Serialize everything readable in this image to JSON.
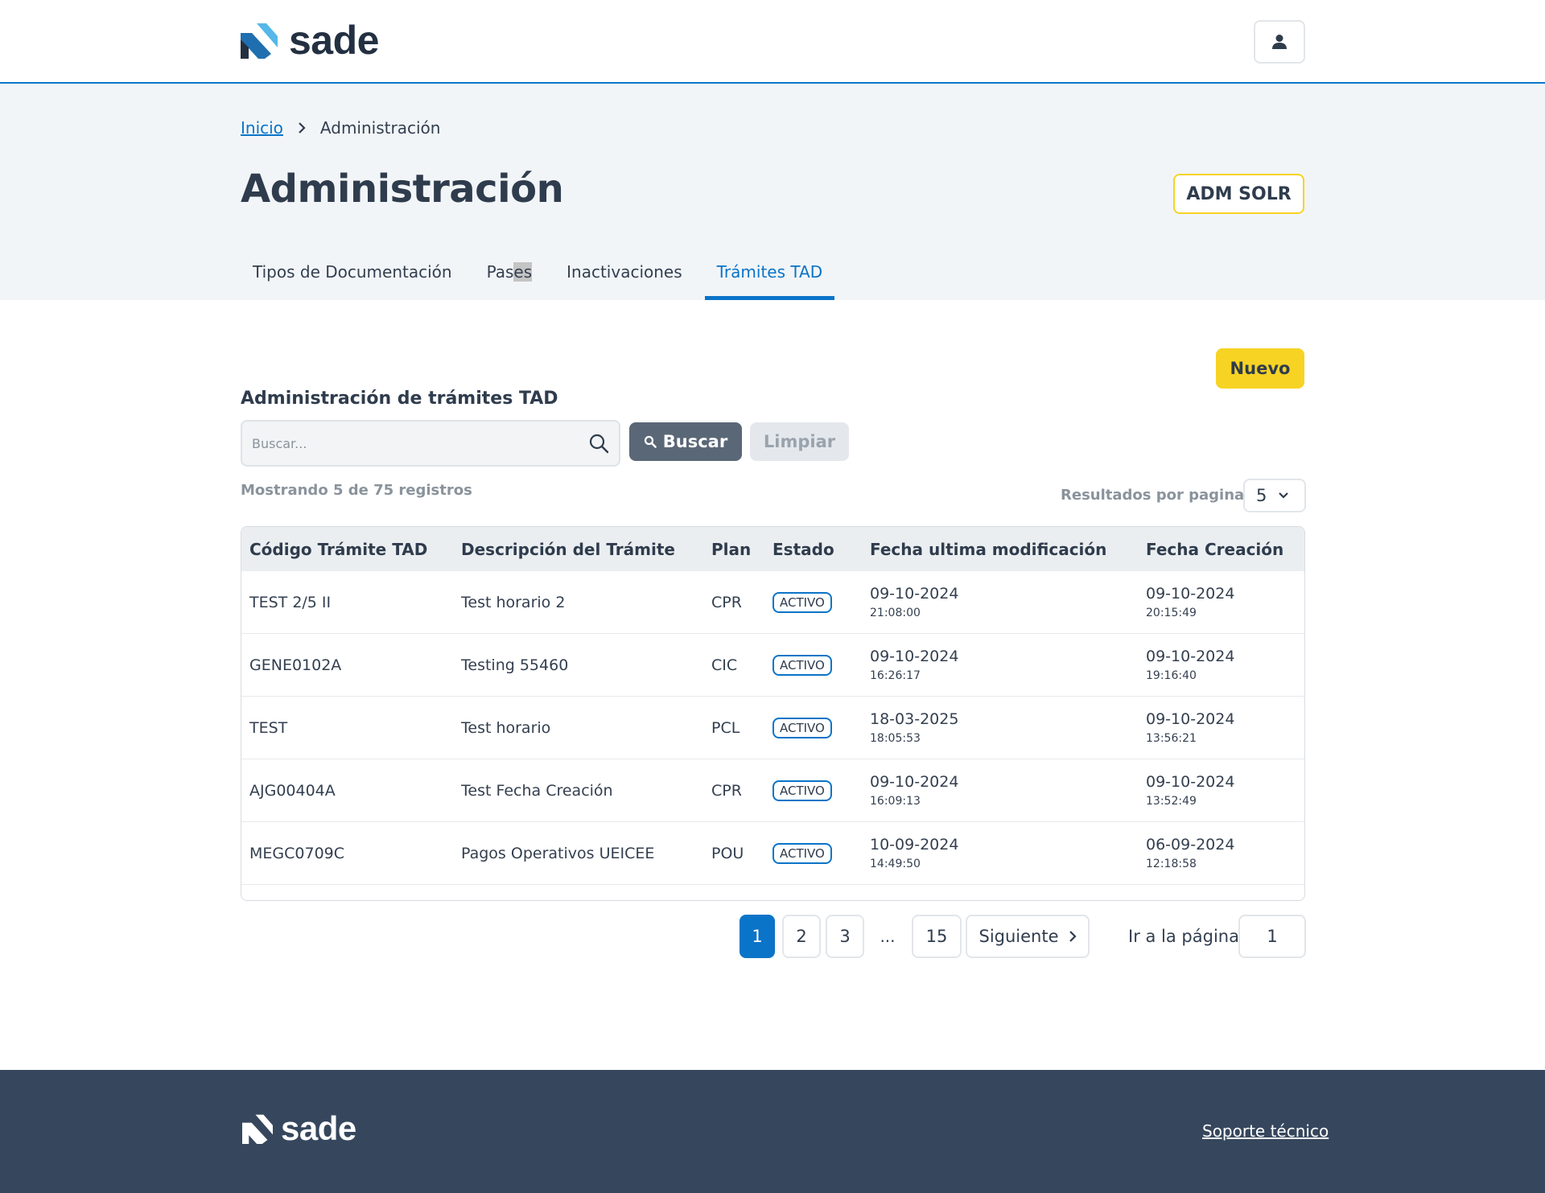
{
  "brand": {
    "name": "sade",
    "colors": {
      "primary": "#0a74c8",
      "accent": "#f7d323",
      "dark": "#36475d"
    }
  },
  "header": {
    "user_icon": "user-icon"
  },
  "breadcrumb": {
    "home": "Inicio",
    "current": "Administración"
  },
  "page": {
    "title": "Administración",
    "adm_button": "ADM SOLR"
  },
  "tabs": [
    {
      "label": "Tipos de Documentación",
      "active": false
    },
    {
      "label_a": "Pas",
      "label_b": "es",
      "active": false
    },
    {
      "label": "Inactivaciones",
      "active": false
    },
    {
      "label": "Trámites TAD",
      "active": true
    }
  ],
  "main": {
    "new_button": "Nuevo",
    "section_title": "Administración de trámites TAD",
    "search": {
      "placeholder": "Buscar...",
      "value": ""
    },
    "search_button": "Buscar",
    "clear_button": "Limpiar",
    "count_text": "Mostrando 5 de 75 registros",
    "per_page_label": "Resultados por pagina",
    "per_page_value": "5"
  },
  "table": {
    "headers": [
      "Código Trámite TAD",
      "Descripción del Trámite",
      "Plan",
      "Estado",
      "Fecha ultima modificación",
      "Fecha Creación"
    ],
    "rows": [
      {
        "code": "TEST 2/5 II",
        "desc": "Test horario 2",
        "plan": "CPR",
        "estado": "ACTIVO",
        "mod_date": "09-10-2024",
        "mod_time": "21:08:00",
        "cre_date": "09-10-2024",
        "cre_time": "20:15:49"
      },
      {
        "code": "GENE0102A",
        "desc": "Testing 55460",
        "plan": "CIC",
        "estado": "ACTIVO",
        "mod_date": "09-10-2024",
        "mod_time": "16:26:17",
        "cre_date": "09-10-2024",
        "cre_time": "19:16:40"
      },
      {
        "code": "TEST",
        "desc": "Test horario",
        "plan": "PCL",
        "estado": "ACTIVO",
        "mod_date": "18-03-2025",
        "mod_time": "18:05:53",
        "cre_date": "09-10-2024",
        "cre_time": "13:56:21"
      },
      {
        "code": "AJG00404A",
        "desc": "Test Fecha Creación",
        "plan": "CPR",
        "estado": "ACTIVO",
        "mod_date": "09-10-2024",
        "mod_time": "16:09:13",
        "cre_date": "09-10-2024",
        "cre_time": "13:52:49"
      },
      {
        "code": "MEGC0709C",
        "desc": "Pagos Operativos UEICEE",
        "plan": "POU",
        "estado": "ACTIVO",
        "mod_date": "10-09-2024",
        "mod_time": "14:49:50",
        "cre_date": "06-09-2024",
        "cre_time": "12:18:58"
      }
    ]
  },
  "pagination": {
    "pages": [
      "1",
      "2",
      "3"
    ],
    "ellipsis": "...",
    "last": "15",
    "next": "Siguiente",
    "goto_label": "Ir a la página",
    "goto_value": "1",
    "current": "1"
  },
  "footer": {
    "brand": "sade",
    "support": "Soporte técnico"
  }
}
